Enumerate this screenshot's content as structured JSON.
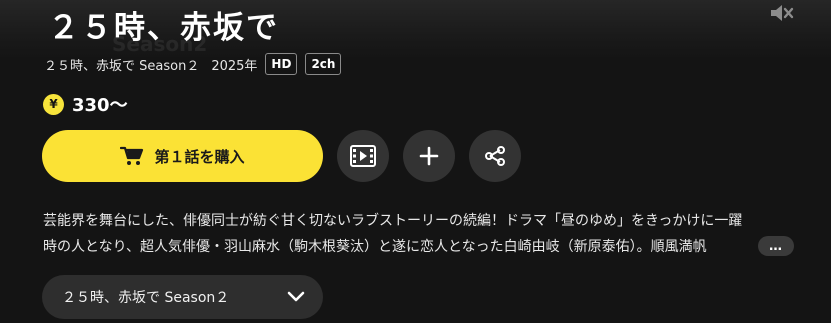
{
  "title": "２５時、赤坂で",
  "meta": {
    "season": "２５時、赤坂で Season２",
    "year": "2025年",
    "badges": [
      "HD",
      "2ch"
    ]
  },
  "price": {
    "coin_symbol": "¥",
    "text": "330〜"
  },
  "actions": {
    "buy_label": "第１話を購入",
    "icons": [
      "trailer-icon",
      "plus-icon",
      "share-icon"
    ]
  },
  "description": {
    "line1": "芸能界を舞台にした、俳優同士が紡ぐ甘く切ないラブストーリーの続編！ドラマ「昼のゆめ」をきっかけに一躍",
    "line2": "時の人となり、超人気俳優・羽山麻水（駒木根葵汰）と遂に恋人となった白崎由岐（新原泰佑）。順風満帆",
    "more_label": "…"
  },
  "season_select": {
    "value": "２５時、赤坂で Season２"
  },
  "colors": {
    "background": "#141414",
    "accent_yellow": "#fbe235",
    "circle_button": "#333333"
  }
}
